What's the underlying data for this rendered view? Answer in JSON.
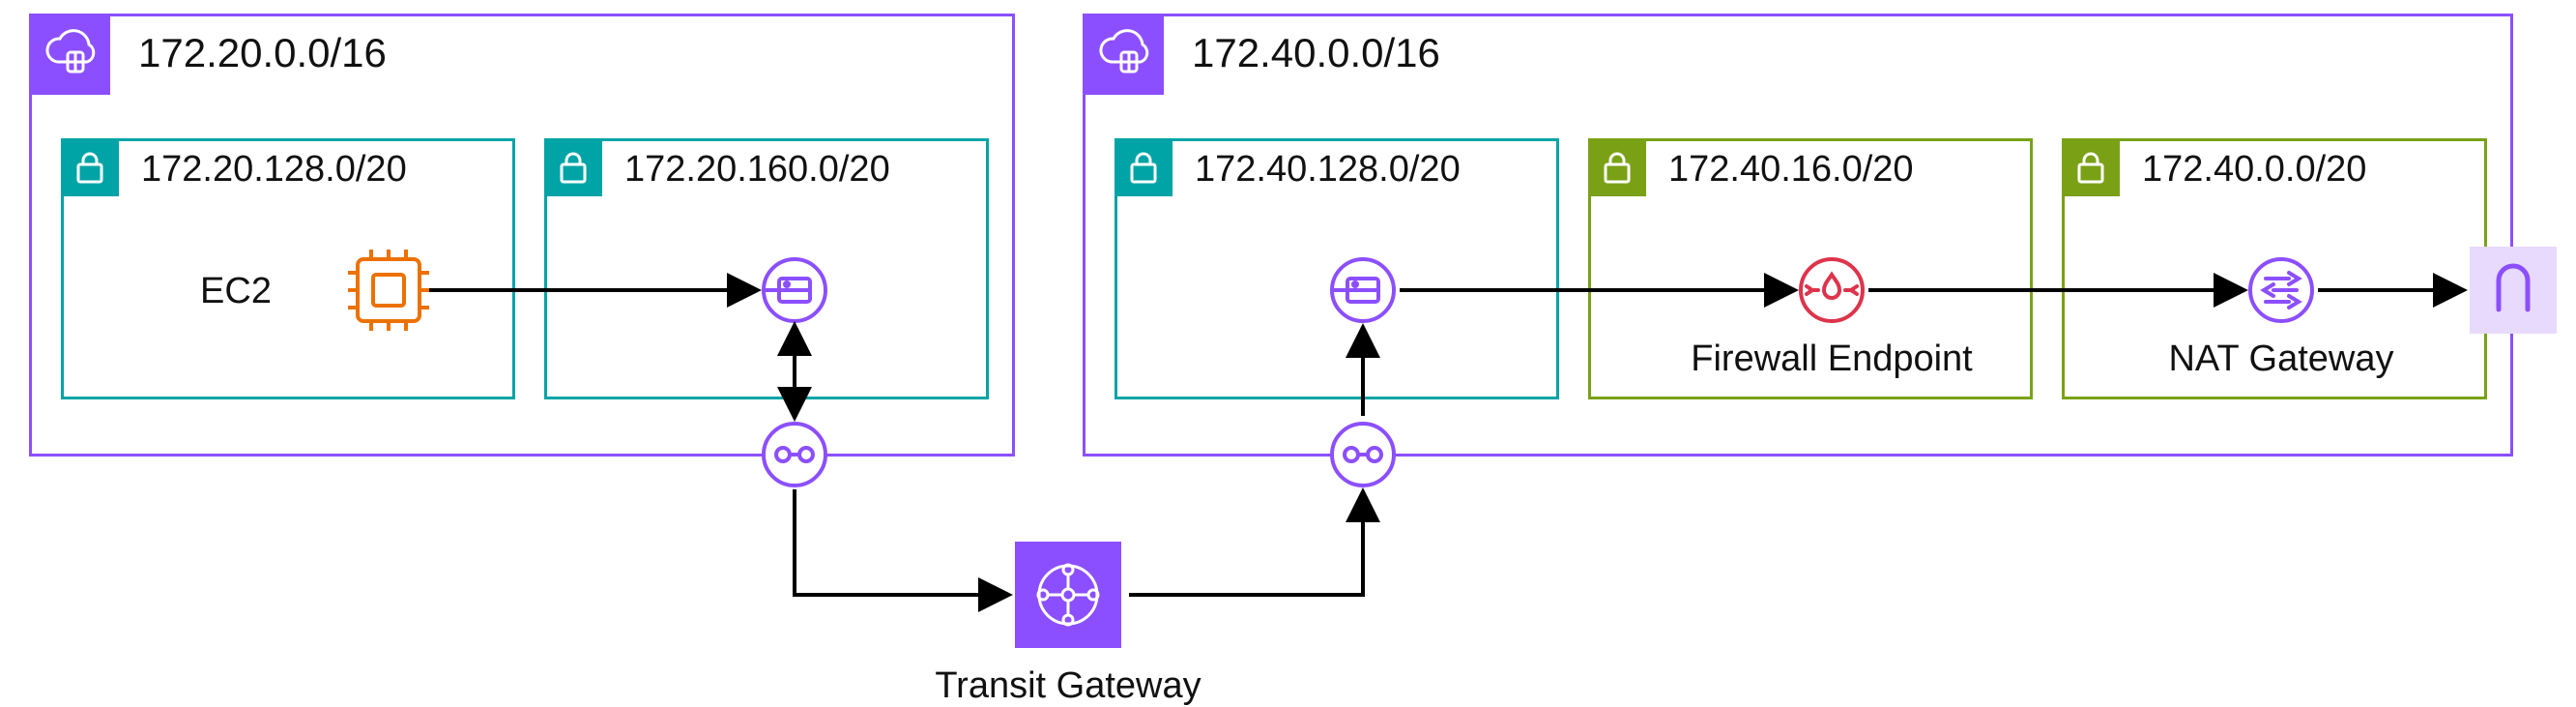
{
  "diagram": {
    "vpc_left": {
      "cidr": "172.20.0.0/16",
      "subnets": {
        "private": {
          "cidr": "172.20.128.0/20"
        },
        "tgw_attach": {
          "cidr": "172.20.160.0/20"
        }
      },
      "resources": {
        "ec2_label": "EC2"
      }
    },
    "vpc_right": {
      "cidr": "172.40.0.0/16",
      "subnets": {
        "tgw_attach": {
          "cidr": "172.40.128.0/20"
        },
        "firewall": {
          "cidr": "172.40.16.0/20"
        },
        "nat": {
          "cidr": "172.40.0.0/20"
        }
      },
      "resources": {
        "firewall_label": "Firewall Endpoint",
        "nat_label": "NAT Gateway"
      }
    },
    "tgw_label": "Transit Gateway",
    "colors": {
      "vpc_border": "#8c4fff",
      "subnet_private": "#00a4a6",
      "subnet_public": "#7aa116",
      "ec2": "#ed7100",
      "firewall": "#dd344c",
      "arrow": "#000000"
    }
  }
}
